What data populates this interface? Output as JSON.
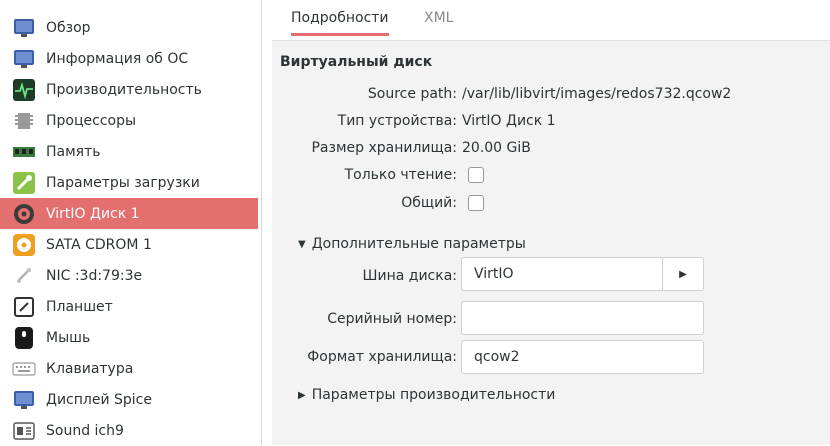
{
  "sidebar": {
    "items": [
      {
        "label": "Обзор",
        "icon": "monitor-icon"
      },
      {
        "label": "Информация об ОС",
        "icon": "monitor-info-icon"
      },
      {
        "label": "Производительность",
        "icon": "performance-graph-icon"
      },
      {
        "label": "Процессоры",
        "icon": "cpu-chip-icon"
      },
      {
        "label": "Память",
        "icon": "memory-module-icon"
      },
      {
        "label": "Параметры загрузки",
        "icon": "wrench-icon"
      },
      {
        "label": "VirtIO Диск 1",
        "icon": "disk-drive-icon"
      },
      {
        "label": "SATA CDROM 1",
        "icon": "cdrom-icon"
      },
      {
        "label": "NIC :3d:79:3e",
        "icon": "network-icon"
      },
      {
        "label": "Планшет",
        "icon": "tablet-icon"
      },
      {
        "label": "Мышь",
        "icon": "mouse-icon"
      },
      {
        "label": "Клавиатура",
        "icon": "keyboard-icon"
      },
      {
        "label": "Дисплей Spice",
        "icon": "display-icon"
      },
      {
        "label": "Sound ich9",
        "icon": "sound-card-icon"
      }
    ],
    "selected": "VirtIO Диск 1"
  },
  "tabs": [
    {
      "label": "Подробности",
      "active": true
    },
    {
      "label": "XML",
      "active": false
    }
  ],
  "details": {
    "title": "Виртуальный диск",
    "source_path_label": "Source path:",
    "source_path_value": "/var/lib/libvirt/images/redos732.qcow2",
    "device_type_label": "Тип устройства:",
    "device_type_value": "VirtIO Диск 1",
    "storage_size_label": "Размер хранилища:",
    "storage_size_value": "20.00 GiB",
    "readonly_label": "Только чтение:",
    "readonly_checked": false,
    "shared_label": "Общий:",
    "shared_checked": false
  },
  "advanced": {
    "label": "Дополнительные параметры",
    "expanded": true,
    "bus_label": "Шина диска:",
    "bus_value": "VirtIO",
    "serial_label": "Серийный номер:",
    "serial_value": "",
    "format_label": "Формат хранилища:",
    "format_value": "qcow2"
  },
  "performance": {
    "label": "Параметры производительности",
    "expanded": false
  },
  "colors": {
    "accent": "#e36f6f",
    "panel_bg": "#f3f3f3"
  }
}
